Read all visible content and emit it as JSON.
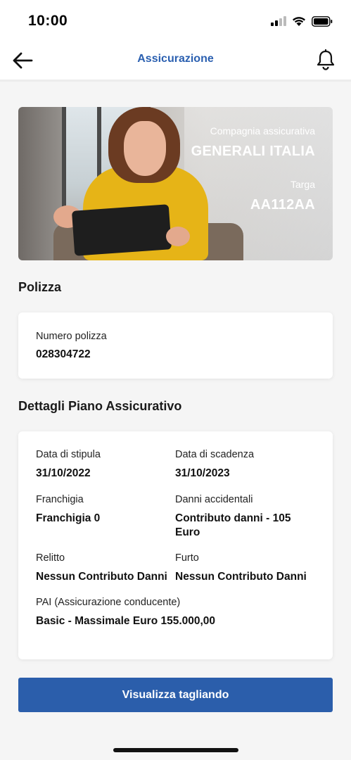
{
  "status_bar": {
    "time": "10:00"
  },
  "header": {
    "title": "Assicurazione"
  },
  "hero": {
    "company_label": "Compagnia assicurativa",
    "company_value": "GENERALI ITALIA",
    "plate_label": "Targa",
    "plate_value": "AA112AA"
  },
  "policy": {
    "section_title": "Polizza",
    "number_label": "Numero polizza",
    "number_value": "028304722"
  },
  "plan": {
    "section_title": "Dettagli Piano Assicurativo",
    "stipula_label": "Data di stipula",
    "stipula_value": "31/10/2022",
    "scadenza_label": "Data di scadenza",
    "scadenza_value": "31/10/2023",
    "franchigia_label": "Franchigia",
    "franchigia_value": "Franchigia 0",
    "danni_label": "Danni accidentali",
    "danni_value": "Contributo danni - 105 Euro",
    "relitto_label": "Relitto",
    "relitto_value": "Nessun Contributo Danni",
    "furto_label": "Furto",
    "furto_value": "Nessun Contributo Danni",
    "pai_label": "PAI (Assicurazione conducente)",
    "pai_value": "Basic - Massimale Euro 155.000,00"
  },
  "cta": {
    "label": "Visualizza tagliando"
  },
  "colors": {
    "accent": "#2b5eab",
    "title_blue": "#2a5fb0",
    "background": "#f5f5f5"
  },
  "icons": [
    "back-arrow-icon",
    "bell-icon",
    "signal-icon",
    "wifi-icon",
    "battery-icon"
  ]
}
